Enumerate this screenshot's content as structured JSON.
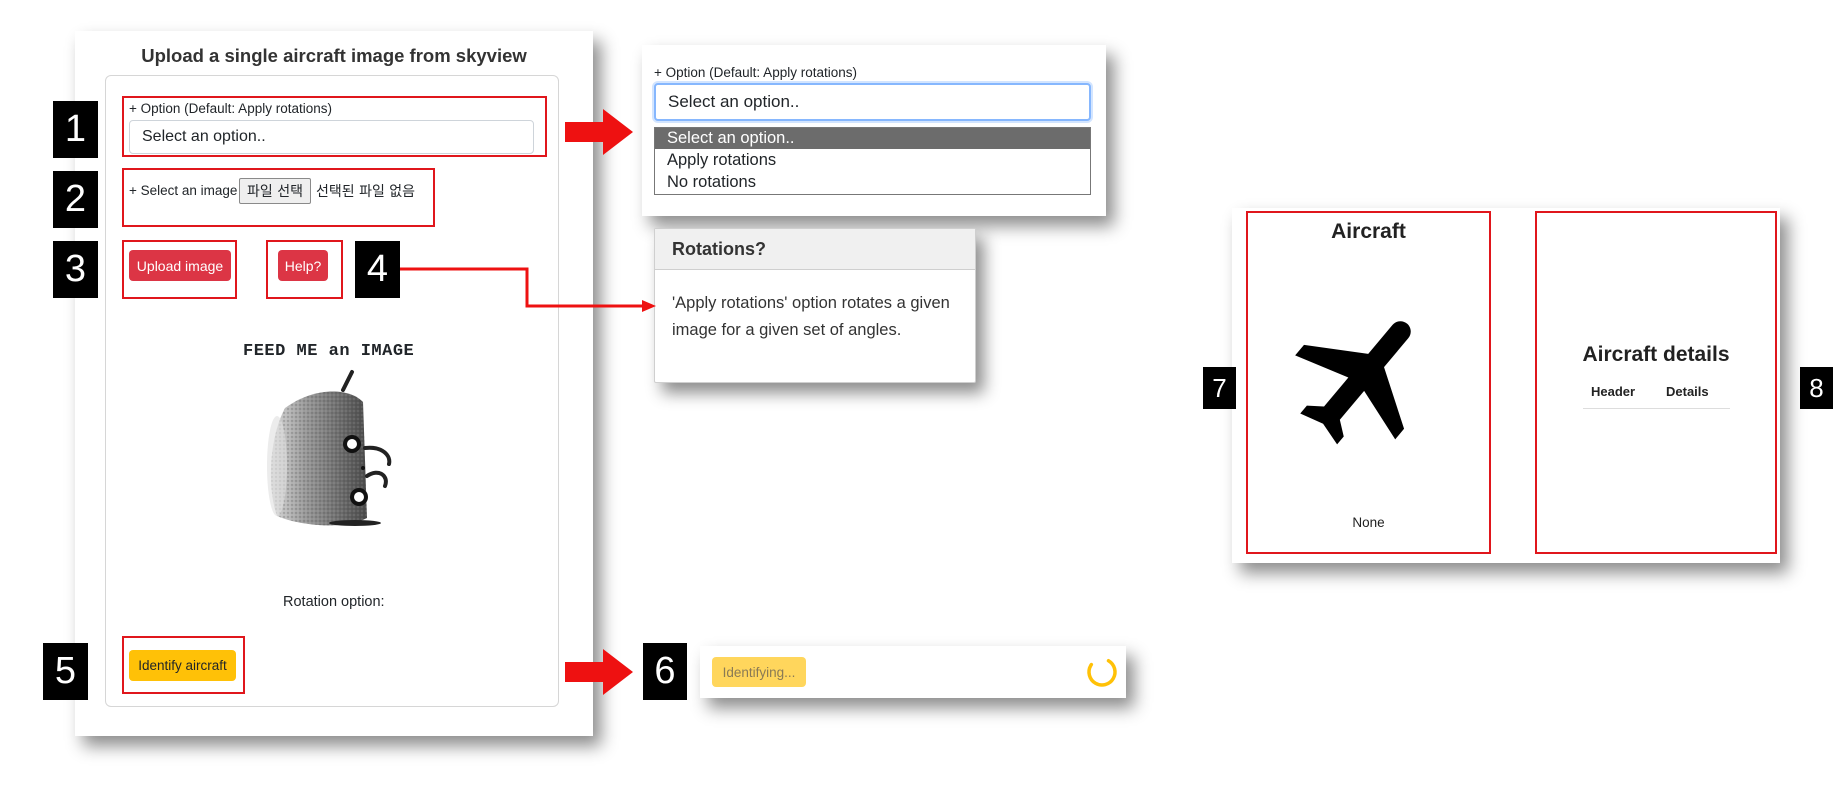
{
  "main_panel": {
    "title": "Upload a single aircraft image from skyview",
    "option_label": "+ Option (Default: Apply rotations)",
    "option_value": "Select an option..",
    "select_image_label": "+ Select an image",
    "file_button": "파일 선택",
    "file_status": "선택된 파일 없음",
    "upload_button": "Upload image",
    "help_button": "Help?",
    "feed_text": "FEED ME an IMAGE",
    "rotation_label": "Rotation option:",
    "identify_button": "Identify aircraft"
  },
  "callouts": [
    "1",
    "2",
    "3",
    "4",
    "5",
    "6",
    "7",
    "8"
  ],
  "dropdown_panel": {
    "label": "+ Option (Default: Apply rotations)",
    "selected": "Select an option..",
    "options": [
      "Select an option..",
      "Apply rotations",
      "No rotations"
    ]
  },
  "help_popup": {
    "title": "Rotations?",
    "body": "'Apply rotations' option rotates a given image for a given set of angles."
  },
  "identifying_panel": {
    "button": "Identifying..."
  },
  "results_panel": {
    "aircraft_title": "Aircraft",
    "aircraft_name": "None",
    "details_title": "Aircraft details",
    "table_headers": [
      "Header",
      "Details"
    ]
  },
  "colors": {
    "red_button": "#dc3545",
    "yellow_button": "#ffc107",
    "callout_border": "#e0161c",
    "arrow": "#ee1111",
    "focus_ring": "#86b7fe",
    "dropdown_highlight": "#6c6c6c"
  }
}
